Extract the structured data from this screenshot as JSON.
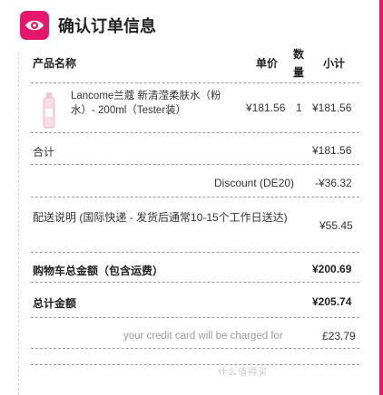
{
  "header": {
    "title": "确认订单信息",
    "icon": "eye-icon"
  },
  "columns": {
    "product": "产品名称",
    "unit_price": "单价",
    "qty_line1": "数",
    "qty_line2": "量",
    "subtotal": "小计"
  },
  "item": {
    "name": "Lancome兰蔻 新清滢柔肤水（粉水）- 200ml（Tester装）",
    "unit_price": "¥181.56",
    "qty": "1",
    "subtotal": "¥181.56"
  },
  "summary": {
    "total_label": "合计",
    "total_value": "¥181.56",
    "discount_label": "Discount (DE20)",
    "discount_value": "-¥36.32",
    "shipping_label": "配送说明 (国际快递 - 发货后通常10-15个工作日送达)",
    "shipping_value": "¥55.45",
    "cart_total_label": "购物车总金额（包含运费）",
    "cart_total_value": "¥200.69",
    "grand_total_label": "总计金额",
    "grand_total_value": "¥205.74",
    "charge_label": "your credit card will be charged for",
    "charge_value": "£23.79"
  },
  "watermark": "什么值得买",
  "colors": {
    "accent": "#e4176d"
  }
}
